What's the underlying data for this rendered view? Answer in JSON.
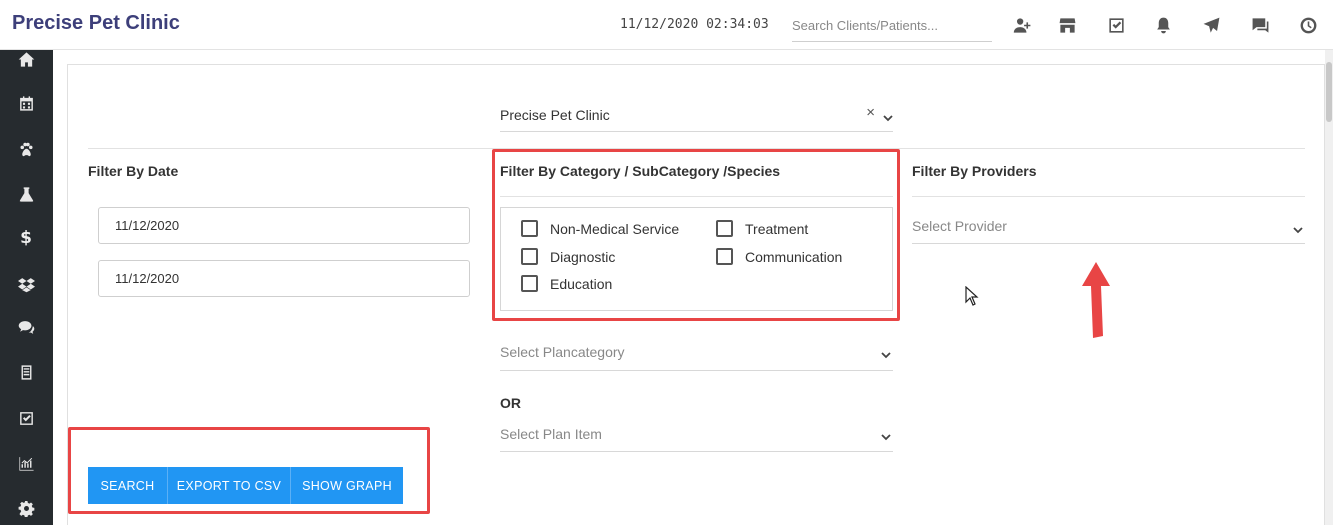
{
  "header": {
    "brand": "Precise Pet Clinic",
    "datetime": "11/12/2020 02:34:03",
    "search_placeholder": "Search Clients/Patients...",
    "icons": [
      "add-user-icon",
      "store-icon",
      "task-check-icon",
      "bell-icon",
      "send-icon",
      "chat-icon",
      "clock-icon"
    ]
  },
  "sidebar": {
    "icons": [
      "home-icon",
      "calendar-icon",
      "paw-icon",
      "flask-icon",
      "dollar-icon",
      "dropbox-icon",
      "comments-icon",
      "document-icon",
      "checkbox-icon",
      "chart-icon",
      "gear-icon"
    ],
    "dollar_glyph": "$"
  },
  "filters": {
    "clinic_value": "Precise Pet Clinic",
    "clear_glyph": "×",
    "date_title": "Filter By Date",
    "date_from": "11/12/2020",
    "date_to": "11/12/2020",
    "category_title": "Filter By Category / SubCategory /Species",
    "categories": [
      {
        "label": "Non-Medical Service",
        "checked": false
      },
      {
        "label": "Treatment",
        "checked": false
      },
      {
        "label": "Diagnostic",
        "checked": false
      },
      {
        "label": "Communication",
        "checked": false
      },
      {
        "label": "Education",
        "checked": false
      }
    ],
    "plancategory_placeholder": "Select Plancategory",
    "or_label": "OR",
    "planitem_placeholder": "Select Plan Item",
    "providers_title": "Filter By Providers",
    "provider_placeholder": "Select Provider"
  },
  "actions": {
    "search": "SEARCH",
    "export": "EXPORT TO CSV",
    "graph": "SHOW GRAPH"
  },
  "colors": {
    "brand": "#3d3f7a",
    "sidebar_bg": "#262b2f",
    "button": "#2196f3",
    "highlight": "#e84545"
  }
}
